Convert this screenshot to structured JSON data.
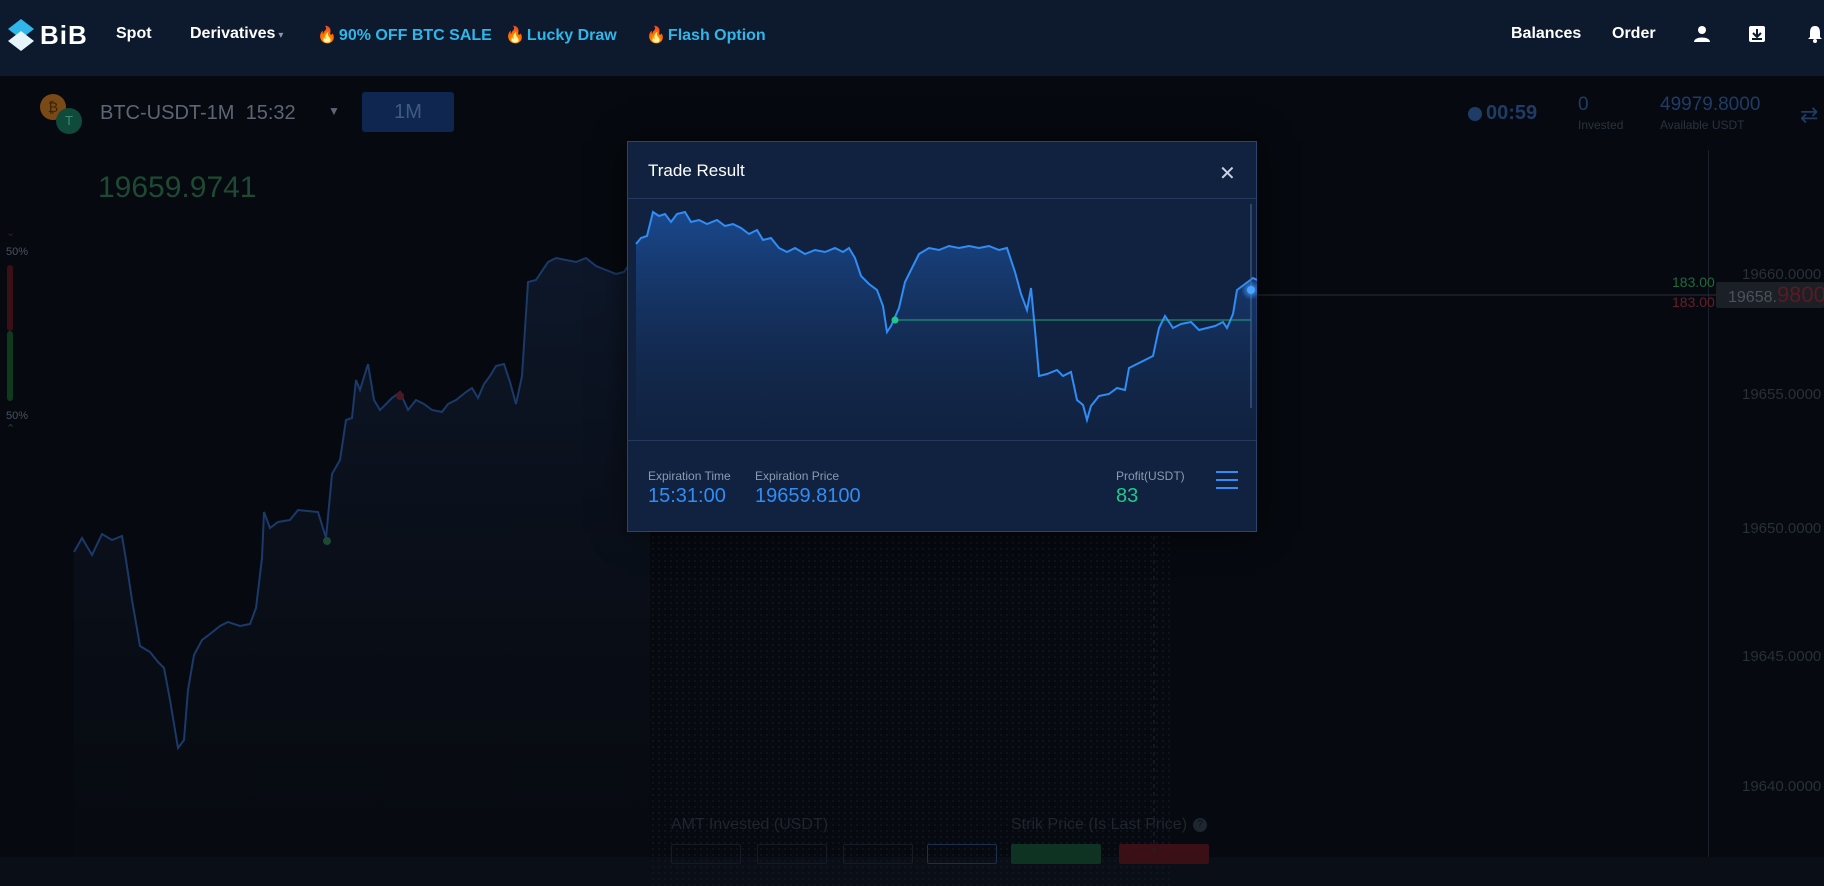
{
  "nav": {
    "logo_text": "BiB",
    "links": {
      "spot": "Spot",
      "derivatives": "Derivatives",
      "btc_sale": "90% OFF BTC SALE",
      "lucky_draw": "Lucky Draw",
      "flash_option": "Flash Option"
    },
    "balances": "Balances",
    "order": "Order",
    "icons": [
      "user-icon",
      "download-icon",
      "bell-icon"
    ]
  },
  "trade_header": {
    "symbol": "BTC-USDT-1M",
    "time": "15:32",
    "period": "1M",
    "countdown": "00:59",
    "invested_value": "0",
    "invested_label": "Invested",
    "available_value": "49979.8000",
    "available_label": "Available USDT"
  },
  "live_price": "19659.9741",
  "sentiment": {
    "up_pct": "50%",
    "down_pct": "50%"
  },
  "price_axis": [
    "19660.0000",
    "19655.0000",
    "19650.0000",
    "19645.0000",
    "19640.0000"
  ],
  "current_tag": {
    "prefix": "19658.",
    "suffix": "9800"
  },
  "side_values": {
    "up": "183.00",
    "down": "183.00"
  },
  "form": {
    "amt_label": "AMT Invested (USDT)",
    "strike_label": "Strik Price (Is Last Price)"
  },
  "modal": {
    "title": "Trade Result",
    "expiration_time_label": "Expiration Time",
    "expiration_time": "15:31:00",
    "expiration_price_label": "Expiration Price",
    "expiration_price": "19659.8100",
    "profit_label": "Profit(USDT)",
    "profit": "83"
  },
  "colors": {
    "nav_bg": "#0d1a2d",
    "accent_blue": "#2f8df5",
    "promo": "#2fb6ea",
    "profit_green": "#1fc98a",
    "modal_bg": "#112240"
  }
}
